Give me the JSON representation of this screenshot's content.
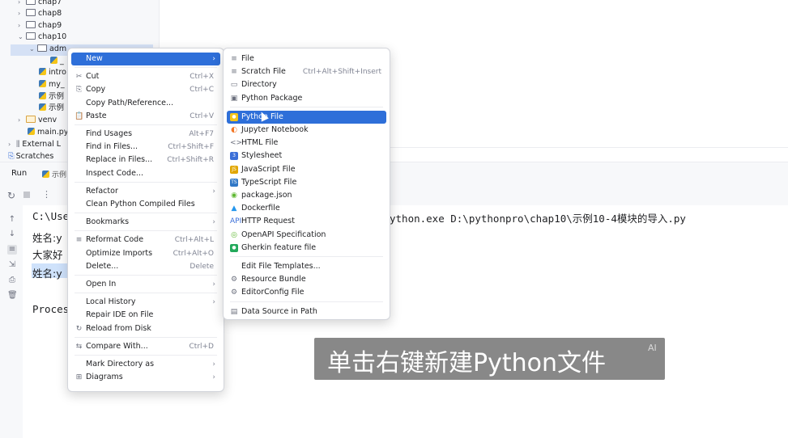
{
  "tree": {
    "items": [
      {
        "label": "chap7",
        "kind": "folder",
        "chev": "›"
      },
      {
        "label": "chap8",
        "kind": "folder",
        "chev": "›"
      },
      {
        "label": "chap9",
        "kind": "folder",
        "chev": "›"
      },
      {
        "label": "chap10",
        "kind": "folder",
        "chev": "⌄"
      },
      {
        "label": "adm",
        "kind": "folder",
        "chev": "⌄"
      },
      {
        "label": "_",
        "kind": "py",
        "chev": ""
      },
      {
        "label": "intro",
        "kind": "py",
        "chev": ""
      },
      {
        "label": "my_",
        "kind": "py",
        "chev": ""
      },
      {
        "label": "示例",
        "kind": "py",
        "chev": ""
      },
      {
        "label": "示例",
        "kind": "py",
        "chev": ""
      },
      {
        "label": "venv",
        "kind": "venv",
        "chev": "›"
      },
      {
        "label": "main.py",
        "kind": "py",
        "chev": ""
      },
      {
        "label": "External L",
        "kind": "lib",
        "chev": "›"
      },
      {
        "label": "Scratches",
        "kind": "scratch",
        "chev": ""
      }
    ]
  },
  "run_panel": {
    "tab_label": "Run",
    "tab2_label": "示例",
    "console_lines": [
      "C:\\Use",
      "姓名:y",
      "大家好",
      "姓名:y",
      "",
      "Proces"
    ],
    "command_tail": "ython.exe D:\\pythonpro\\chap10\\示例10-4模块的导入.py"
  },
  "context_menu": {
    "items": [
      {
        "label": "New",
        "shortcut": "",
        "arrow": true,
        "icon": "",
        "highlight": true,
        "underline": "N"
      },
      {
        "sep": true
      },
      {
        "label": "Cut",
        "shortcut": "Ctrl+X",
        "icon": "scissors-icon",
        "glyph": "✂"
      },
      {
        "label": "Copy",
        "shortcut": "Ctrl+C",
        "icon": "copy-icon",
        "glyph": "⎘"
      },
      {
        "label": "Copy Path/Reference...",
        "shortcut": ""
      },
      {
        "label": "Paste",
        "shortcut": "Ctrl+V",
        "icon": "paste-icon",
        "glyph": "📋"
      },
      {
        "sep": true
      },
      {
        "label": "Find Usages",
        "shortcut": "Alt+F7"
      },
      {
        "label": "Find in Files...",
        "shortcut": "Ctrl+Shift+F"
      },
      {
        "label": "Replace in Files...",
        "shortcut": "Ctrl+Shift+R"
      },
      {
        "label": "Inspect Code...",
        "shortcut": ""
      },
      {
        "sep": true
      },
      {
        "label": "Refactor",
        "shortcut": "",
        "arrow": true
      },
      {
        "label": "Clean Python Compiled Files",
        "shortcut": ""
      },
      {
        "sep": true
      },
      {
        "label": "Bookmarks",
        "shortcut": "",
        "arrow": true
      },
      {
        "sep": true
      },
      {
        "label": "Reformat Code",
        "shortcut": "Ctrl+Alt+L",
        "icon": "reformat-icon",
        "glyph": "≡"
      },
      {
        "label": "Optimize Imports",
        "shortcut": "Ctrl+Alt+O"
      },
      {
        "label": "Delete...",
        "shortcut": "Delete"
      },
      {
        "sep": true
      },
      {
        "label": "Open In",
        "shortcut": "",
        "arrow": true
      },
      {
        "sep": true
      },
      {
        "label": "Local History",
        "shortcut": "",
        "arrow": true
      },
      {
        "label": "Repair IDE on File",
        "shortcut": ""
      },
      {
        "label": "Reload from Disk",
        "shortcut": "",
        "icon": "reload-icon",
        "glyph": "↻"
      },
      {
        "sep": true
      },
      {
        "label": "Compare With...",
        "shortcut": "Ctrl+D",
        "icon": "compare-icon",
        "glyph": "⇆"
      },
      {
        "sep": true
      },
      {
        "label": "Mark Directory as",
        "shortcut": "",
        "arrow": true
      },
      {
        "label": "Diagrams",
        "shortcut": "",
        "arrow": true,
        "icon": "diagram-icon",
        "glyph": "⊞"
      }
    ]
  },
  "submenu": {
    "items": [
      {
        "label": "File",
        "shortcut": "",
        "icon": "file-icon",
        "color": "#6c707e"
      },
      {
        "label": "Scratch File",
        "shortcut": "Ctrl+Alt+Shift+Insert",
        "icon": "scratch-icon",
        "color": "#6c707e"
      },
      {
        "label": "Directory",
        "shortcut": "",
        "icon": "folder-icon",
        "color": "#6c707e"
      },
      {
        "label": "Python Package",
        "shortcut": "",
        "icon": "package-icon",
        "color": "#6c707e"
      },
      {
        "sep": true
      },
      {
        "label": "Python File",
        "shortcut": "",
        "icon": "python-icon",
        "color": "#f5c518",
        "highlight": true
      },
      {
        "label": "Jupyter Notebook",
        "shortcut": "",
        "icon": "jupyter-icon",
        "color": "#f37726"
      },
      {
        "label": "HTML File",
        "shortcut": "",
        "icon": "html-icon",
        "color": "#6c707e"
      },
      {
        "label": "Stylesheet",
        "shortcut": "",
        "icon": "css-icon",
        "color": "#3b6fd8"
      },
      {
        "label": "JavaScript File",
        "shortcut": "",
        "icon": "js-icon",
        "color": "#e1a600"
      },
      {
        "label": "TypeScript File",
        "shortcut": "",
        "icon": "ts-icon",
        "color": "#3178c6"
      },
      {
        "label": "package.json",
        "shortcut": "",
        "icon": "npm-icon",
        "color": "#5fb832"
      },
      {
        "label": "Dockerfile",
        "shortcut": "",
        "icon": "docker-icon",
        "color": "#2496ed"
      },
      {
        "label": "HTTP Request",
        "shortcut": "",
        "icon": "api-icon",
        "color": "#3b6fd8"
      },
      {
        "label": "OpenAPI Specification",
        "shortcut": "",
        "icon": "openapi-icon",
        "color": "#5fb832"
      },
      {
        "label": "Gherkin feature file",
        "shortcut": "",
        "icon": "gherkin-icon",
        "color": "#23a95b"
      },
      {
        "sep": true
      },
      {
        "label": "Edit File Templates...",
        "shortcut": ""
      },
      {
        "label": "Resource Bundle",
        "shortcut": "",
        "icon": "bundle-icon",
        "color": "#6c707e"
      },
      {
        "label": "EditorConfig File",
        "shortcut": "",
        "icon": "gear-icon",
        "color": "#6c707e"
      },
      {
        "sep": true
      },
      {
        "label": "Data Source in Path",
        "shortcut": "",
        "icon": "database-icon",
        "color": "#6c707e"
      }
    ]
  },
  "caption": {
    "text": "单击右键新建Python文件",
    "mark": "AI"
  },
  "colors": {
    "highlight": "#2e6fd9",
    "tree_selection": "#d5e1f5"
  }
}
